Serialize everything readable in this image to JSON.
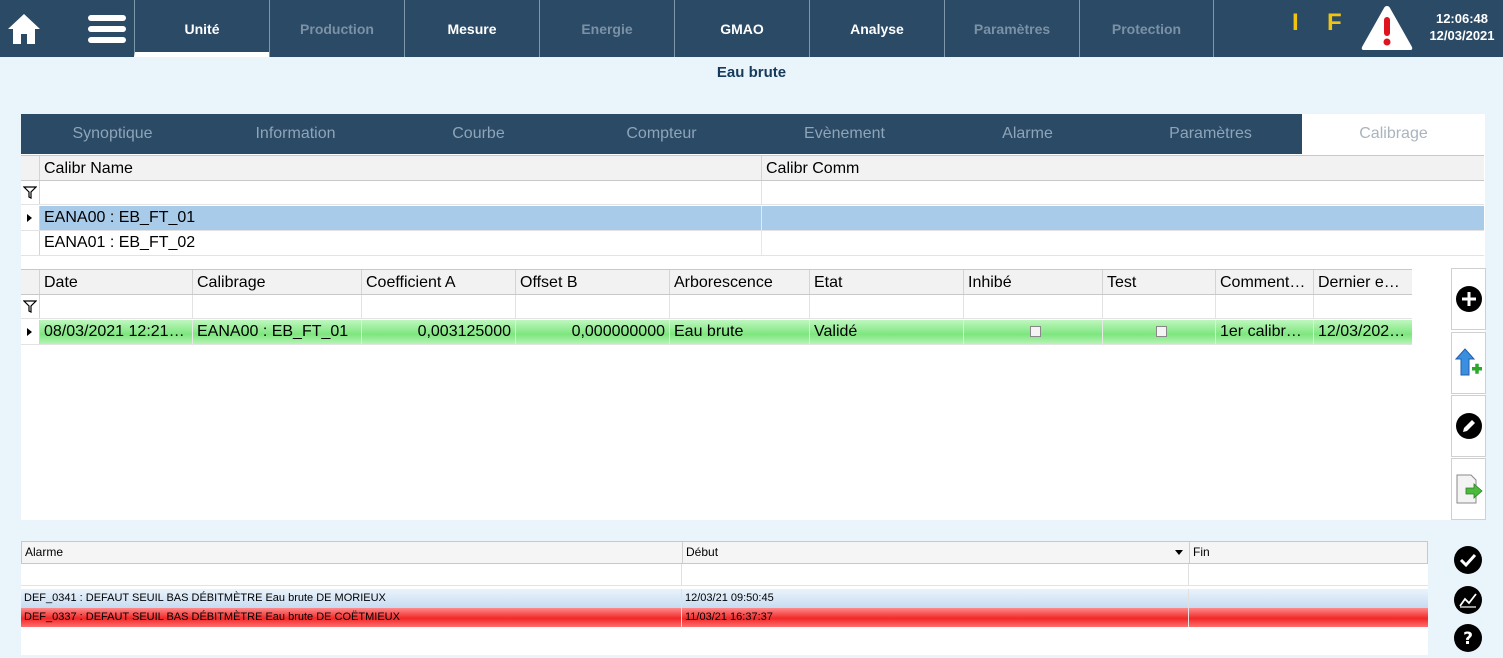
{
  "header": {
    "tabs": [
      {
        "label": "Unité",
        "state": "active"
      },
      {
        "label": "Production",
        "state": "disabled"
      },
      {
        "label": "Mesure",
        "state": "enabled"
      },
      {
        "label": "Energie",
        "state": "disabled"
      },
      {
        "label": "GMAO",
        "state": "enabled"
      },
      {
        "label": "Analyse",
        "state": "enabled"
      },
      {
        "label": "Paramètres",
        "state": "disabled"
      },
      {
        "label": "Protection",
        "state": "disabled"
      }
    ],
    "indicator_i": "I",
    "indicator_f": "F",
    "time": "12:06:48",
    "date": "12/03/2021",
    "accent_color": "#2b4a66",
    "indicator_color": "#f1c40f"
  },
  "page_title": "Eau brute",
  "subtabs": [
    {
      "label": "Synoptique"
    },
    {
      "label": "Information"
    },
    {
      "label": "Courbe"
    },
    {
      "label": "Compteur"
    },
    {
      "label": "Evènement"
    },
    {
      "label": "Alarme"
    },
    {
      "label": "Paramètres"
    },
    {
      "label": "Calibrage",
      "active": true
    }
  ],
  "calib_list": {
    "columns": [
      "Calibr Name",
      "Calibr Comm"
    ],
    "rows": [
      {
        "name": "EANA00 : EB_FT_01",
        "comm": "",
        "selected": true
      },
      {
        "name": "EANA01 : EB_FT_02",
        "comm": "",
        "selected": false
      }
    ]
  },
  "calib_details": {
    "columns": [
      "Date",
      "Calibrage",
      "Coefficient A",
      "Offset B",
      "Arborescence",
      "Etat",
      "Inhibé",
      "Test",
      "Comment…",
      "Dernier e…"
    ],
    "rows": [
      {
        "date": "08/03/2021  12:21…",
        "calibrage": "EANA00 : EB_FT_01",
        "coef_a": "0,003125000",
        "offset_b": "0,000000000",
        "arborescence": "Eau brute",
        "etat": "Validé",
        "inhibe": false,
        "test": false,
        "comment": "1er calibr…",
        "dernier": "12/03/202…"
      }
    ],
    "row_color": "#8ee88e"
  },
  "side_actions": [
    "add-icon",
    "upload-add-icon",
    "edit-icon",
    "export-icon"
  ],
  "alarms": {
    "columns": [
      "Alarme",
      "Début",
      "Fin"
    ],
    "rows": [
      {
        "alarme": "DEF_0341 : DEFAUT SEUIL BAS DÉBITMÈTRE Eau brute DE MORIEUX",
        "debut": "12/03/21 09:50:45",
        "fin": "",
        "color": "#c7dcf1"
      },
      {
        "alarme": "DEF_0337 : DEFAUT SEUIL BAS DÉBITMÈTRE Eau brute DE COËTMIEUX",
        "debut": "11/03/21 16:37:37",
        "fin": "",
        "color": "#f12828"
      }
    ],
    "actions": [
      "check-icon",
      "chart-icon",
      "help-icon"
    ]
  }
}
